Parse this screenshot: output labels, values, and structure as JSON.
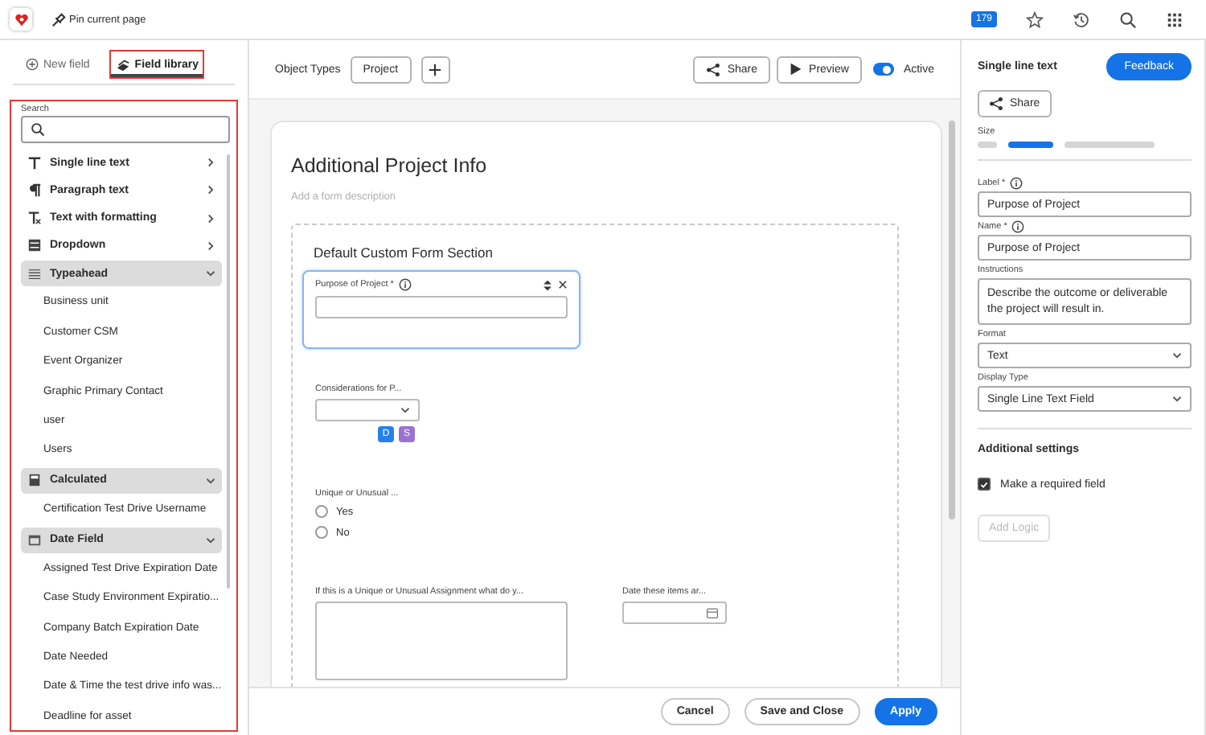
{
  "top_bar": {
    "pin_label": "Pin current page",
    "notification_count": "179"
  },
  "left_tabs": [
    {
      "label": "New field",
      "selected": false,
      "highlighted": false
    },
    {
      "label": "Field library",
      "selected": true,
      "highlighted": true
    }
  ],
  "library": {
    "highlighted": true,
    "search_label": "Search",
    "items": [
      {
        "label": "Single line text",
        "kind": "single-line",
        "expanded": false
      },
      {
        "label": "Paragraph text",
        "kind": "paragraph",
        "expanded": false
      },
      {
        "label": "Text with formatting",
        "kind": "formatting",
        "expanded": false
      },
      {
        "label": "Dropdown",
        "kind": "dropdown",
        "expanded": false
      },
      {
        "label": "Typeahead",
        "kind": "typeahead",
        "expanded": true,
        "children": [
          {
            "label": "Business unit"
          },
          {
            "label": "Customer CSM"
          },
          {
            "label": "Event Organizer"
          },
          {
            "label": "Graphic Primary Contact"
          },
          {
            "label": "user"
          },
          {
            "label": "Users"
          }
        ]
      },
      {
        "label": "Calculated",
        "kind": "calculated",
        "expanded": true,
        "children": [
          {
            "label": "Certification Test Drive Username"
          }
        ]
      },
      {
        "label": "Date Field",
        "kind": "date",
        "expanded": true,
        "children": [
          {
            "label": "Assigned Test Drive Expiration Date"
          },
          {
            "label": "Case Study Environment Expiratio..."
          },
          {
            "label": "Company Batch Expiration Date"
          },
          {
            "label": "Date Needed"
          },
          {
            "label": "Date & Time the test drive info was..."
          },
          {
            "label": "Deadline for asset"
          }
        ]
      }
    ]
  },
  "toolbar": {
    "object_types_label": "Object Types",
    "object_type": "Project",
    "share": "Share",
    "preview": "Preview",
    "active": {
      "label": "Active",
      "on": true
    }
  },
  "form": {
    "title": "Additional Project Info",
    "description_placeholder": "Add a form description",
    "section_title": "Default Custom Form Section",
    "rows": [
      [
        {
          "kind": "text",
          "label": "Purpose of Project *",
          "selected": true
        }
      ],
      [
        {
          "kind": "dropdown",
          "label": "Considerations for P...",
          "selected": false,
          "badges": [
            {
              "text": "D",
              "color": "#2680eb"
            },
            {
              "text": "S",
              "color": "#9b72cf"
            }
          ]
        }
      ],
      [
        {
          "kind": "radio",
          "label": "Unique or Unusual ...",
          "selected": false,
          "options": [
            {
              "label": "Yes",
              "selected": false
            },
            {
              "label": "No",
              "selected": false
            }
          ]
        }
      ],
      [
        {
          "kind": "textarea",
          "label": "If this is a Unique or Unusual Assignment what do y...",
          "selected": false
        },
        {
          "kind": "date",
          "label": "Date these items ar...",
          "selected": false
        }
      ]
    ]
  },
  "footer_buttons": [
    {
      "label": "Cancel",
      "kind": "secondary"
    },
    {
      "label": "Save and Close",
      "kind": "secondary"
    },
    {
      "label": "Apply",
      "kind": "primary"
    }
  ],
  "properties": {
    "title": "Single line text",
    "feedback": "Feedback",
    "share": "Share",
    "size_label": "Size",
    "sizes": [
      {
        "selected": false
      },
      {
        "selected": true
      },
      {
        "selected": false
      }
    ],
    "fields": [
      {
        "kind": "input",
        "label": "Label *",
        "info": true,
        "value": "Purpose of Project"
      },
      {
        "kind": "input",
        "label": "Name *",
        "info": true,
        "value": "Purpose of Project"
      },
      {
        "kind": "textarea",
        "label": "Instructions",
        "info": false,
        "value": "Describe the outcome or deliverable the project will result in."
      },
      {
        "kind": "select",
        "label": "Format",
        "info": false,
        "value": "Text"
      },
      {
        "kind": "select",
        "label": "Display Type",
        "info": false,
        "value": "Single Line Text Field"
      }
    ],
    "additional_title": "Additional settings",
    "required": {
      "label": "Make a required field",
      "checked": true
    },
    "add_logic": {
      "label": "Add Logic",
      "disabled": true
    }
  }
}
